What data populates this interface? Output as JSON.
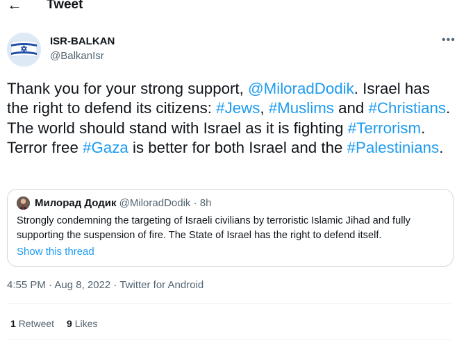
{
  "header": {
    "title": "Tweet",
    "back_icon": "arrow-left-icon"
  },
  "author": {
    "name": "ISR-BALKAN",
    "handle": "@BalkanIsr",
    "avatar_icon": "israeli-flag-avatar"
  },
  "more_icon": "more-horizontal-icon",
  "tweet": {
    "segments": [
      {
        "text": "Thank you for your strong support, ",
        "link": false
      },
      {
        "text": "@MiloradDodik",
        "link": true
      },
      {
        "text": ". Israel has the right to defend its citizens: ",
        "link": false
      },
      {
        "text": "#Jews",
        "link": true
      },
      {
        "text": ", ",
        "link": false
      },
      {
        "text": "#Muslims",
        "link": true
      },
      {
        "text": " and ",
        "link": false
      },
      {
        "text": "#Christians",
        "link": true
      },
      {
        "text": ". The world should stand with Israel as it is fighting ",
        "link": false
      },
      {
        "text": "#Terrorism",
        "link": true
      },
      {
        "text": ". Terror free ",
        "link": false
      },
      {
        "text": "#Gaza",
        "link": true
      },
      {
        "text": " is better for both Israel and the ",
        "link": false
      },
      {
        "text": "#Palestinians",
        "link": true
      },
      {
        "text": ".",
        "link": false
      }
    ]
  },
  "quote": {
    "name": "Милорад Додик",
    "handle": "@MiloradDodik",
    "separator": "·",
    "time": "8h",
    "text": "Strongly condemning the targeting of Israeli civilians by terroristic Islamic Jihad and fully supporting the suspension of fire. The State of Israel has the right to defend itself.",
    "show_thread": "Show this thread"
  },
  "meta": {
    "timestamp": "4:55 PM · Aug 8, 2022 · Twitter for Android"
  },
  "stats": {
    "retweets_count": "1",
    "retweets_label": "Retweet",
    "likes_count": "9",
    "likes_label": "Likes"
  },
  "colors": {
    "link": "#1d9bf0",
    "text": "#0f1419",
    "secondary": "#536471",
    "border": "#cfd9de"
  }
}
